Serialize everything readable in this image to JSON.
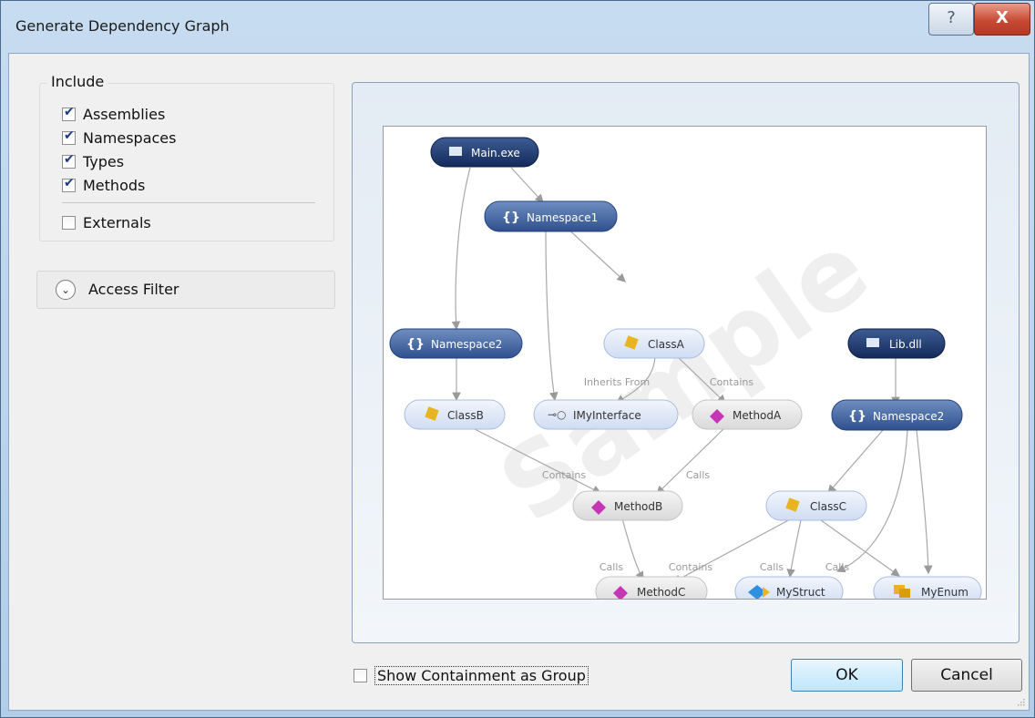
{
  "window": {
    "title": "Generate Dependency Graph",
    "help_glyph": "?",
    "close_glyph": "X"
  },
  "include": {
    "legend": "Include",
    "items": [
      {
        "label": "Assemblies",
        "checked": true
      },
      {
        "label": "Namespaces",
        "checked": true
      },
      {
        "label": "Types",
        "checked": true
      },
      {
        "label": "Methods",
        "checked": true
      }
    ],
    "externals": {
      "label": "Externals",
      "checked": false
    }
  },
  "access_filter": {
    "label": "Access Filter",
    "icon": "chevron-down-circle-icon"
  },
  "graph": {
    "watermark": "Sample",
    "nodes": [
      {
        "id": "main",
        "label": "Main.exe",
        "kind": "assembly"
      },
      {
        "id": "ns1",
        "label": "Namespace1",
        "kind": "namespace"
      },
      {
        "id": "ns2",
        "label": "Namespace2",
        "kind": "namespace"
      },
      {
        "id": "classA",
        "label": "ClassA",
        "kind": "class"
      },
      {
        "id": "lib",
        "label": "Lib.dll",
        "kind": "assembly"
      },
      {
        "id": "classB",
        "label": "ClassB",
        "kind": "class"
      },
      {
        "id": "imy",
        "label": "IMyInterface",
        "kind": "interface"
      },
      {
        "id": "methodA",
        "label": "MethodA",
        "kind": "method"
      },
      {
        "id": "ns2b",
        "label": "Namespace2",
        "kind": "namespace"
      },
      {
        "id": "methodB",
        "label": "MethodB",
        "kind": "method"
      },
      {
        "id": "classC",
        "label": "ClassC",
        "kind": "class"
      },
      {
        "id": "methodC",
        "label": "MethodC",
        "kind": "method"
      },
      {
        "id": "mystruct",
        "label": "MyStruct",
        "kind": "struct"
      },
      {
        "id": "myenum",
        "label": "MyEnum",
        "kind": "enum"
      }
    ],
    "edge_labels": {
      "inherits_from": "Inherits From",
      "contains_a": "Contains",
      "contains_b": "Contains",
      "calls_a": "Calls",
      "calls_b": "Calls",
      "contains_c": "Contains",
      "calls_c": "Calls",
      "calls_d": "Calls"
    }
  },
  "bottom": {
    "show_containment": {
      "label": "Show Containment as Group",
      "checked": false
    },
    "ok_label": "OK",
    "cancel_label": "Cancel"
  },
  "colors": {
    "assembly_fill": "#1f3a6e",
    "namespace_fill": "#3a5f99",
    "class_fill": "#dfe8f7",
    "method_fill": "#e6e6e6"
  }
}
